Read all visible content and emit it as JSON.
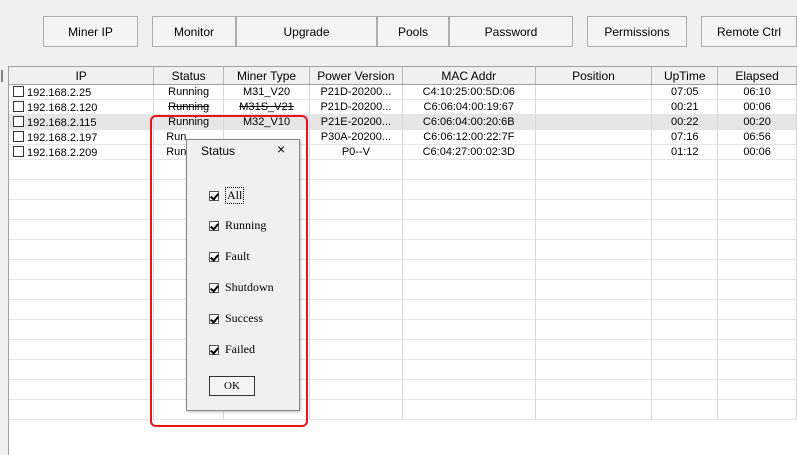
{
  "toolbar": {
    "buttons": [
      "Miner IP",
      "Monitor",
      "Upgrade",
      "Pools",
      "Password",
      "Permissions",
      "Remote Ctrl"
    ]
  },
  "table": {
    "columns": [
      "IP",
      "Status",
      "Miner Type",
      "Power Version",
      "MAC Addr",
      "Position",
      "UpTime",
      "Elapsed"
    ],
    "rows": [
      {
        "ip": "192.168.2.25",
        "status": "Running",
        "type": "M31_V20",
        "power": "P21D-20200...",
        "mac": "C4:10:25:00:5D:06",
        "position": "",
        "uptime": "07:05",
        "elapsed": "06:10"
      },
      {
        "ip": "192.168.2.120",
        "status": "Running",
        "type": "M31S_V21",
        "power": "P21D-20200...",
        "mac": "C6:06:04:00:19:67",
        "position": "",
        "uptime": "00:21",
        "elapsed": "00:06"
      },
      {
        "ip": "192.168.2.115",
        "status": "Running",
        "type": "M32_V10",
        "power": "P21E-20200...",
        "mac": "C6:06:04:00:20:6B",
        "position": "",
        "uptime": "00:22",
        "elapsed": "00:20"
      },
      {
        "ip": "192.168.2.197",
        "status": "Run",
        "type": "",
        "power": "P30A-20200...",
        "mac": "C6:06:12:00:22:7F",
        "position": "",
        "uptime": "07:16",
        "elapsed": "06:56"
      },
      {
        "ip": "192.168.2.209",
        "status": "Run",
        "type": "",
        "power": "P0--V",
        "mac": "C6:04:27:00:02:3D",
        "position": "",
        "uptime": "01:12",
        "elapsed": "00:06"
      }
    ]
  },
  "dialog": {
    "title": "Status",
    "close": "×",
    "options": [
      "All",
      "Running",
      "Fault",
      "Shutdown",
      "Success",
      "Failed"
    ],
    "ok_label": "OK"
  },
  "colors": {
    "highlight": "#e8141c"
  }
}
